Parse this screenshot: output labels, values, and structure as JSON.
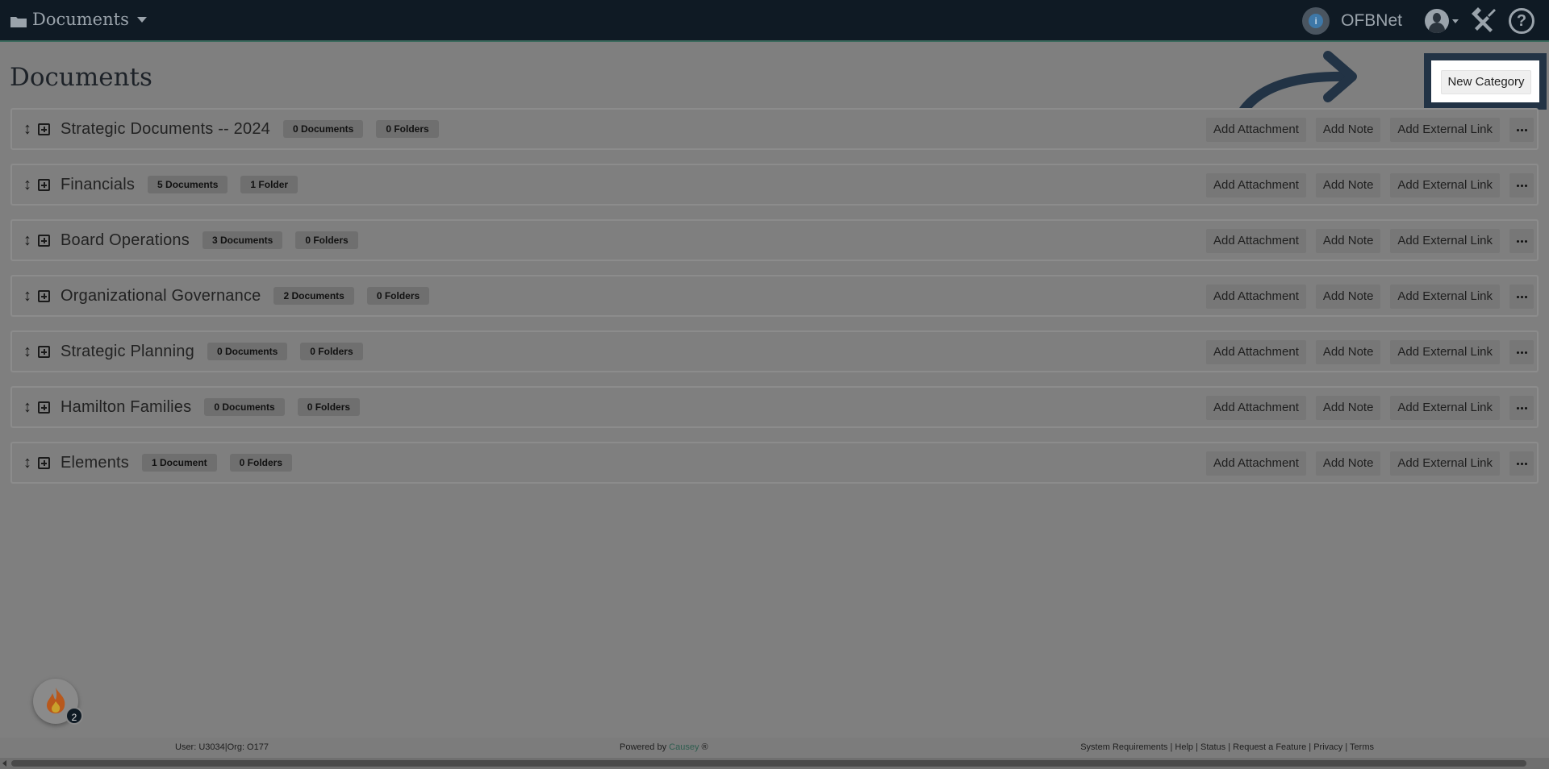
{
  "header": {
    "section_label": "Documents",
    "org_name": "OFBNet",
    "org_icon_glyph": "i",
    "icons": [
      "folder-icon",
      "caret-down-icon",
      "org-info-icon",
      "user-avatar-icon",
      "tools-icon",
      "help-icon"
    ],
    "help_glyph": "?"
  },
  "page": {
    "title": "Documents",
    "new_category_label": "New Category"
  },
  "actions": {
    "add_attachment": "Add Attachment",
    "add_note": "Add Note",
    "add_external_link": "Add External Link"
  },
  "categories": [
    {
      "name": "Strategic Documents -- 2024",
      "documents": "0 Documents",
      "folders": "0 Folders"
    },
    {
      "name": "Financials",
      "documents": "5 Documents",
      "folders": "1 Folder"
    },
    {
      "name": "Board Operations",
      "documents": "3 Documents",
      "folders": "0 Folders"
    },
    {
      "name": "Organizational Governance",
      "documents": "2 Documents",
      "folders": "0 Folders"
    },
    {
      "name": "Strategic Planning",
      "documents": "0 Documents",
      "folders": "0 Folders"
    },
    {
      "name": "Hamilton Families",
      "documents": "0 Documents",
      "folders": "0 Folders"
    },
    {
      "name": "Elements",
      "documents": "1 Document",
      "folders": "0 Folders"
    }
  ],
  "badge": {
    "count": "2"
  },
  "footer": {
    "user_info": "User: U3034|Org: O177",
    "powered_prefix": "Powered by",
    "powered_brand": "Causey",
    "powered_suffix": "®",
    "links": "System Requirements | Help | Status | Request a Feature | Privacy | Terms"
  },
  "colors": {
    "navbar": "#0f1a24",
    "highlight_frame": "#223345",
    "overlay": "#7f7f7f"
  }
}
